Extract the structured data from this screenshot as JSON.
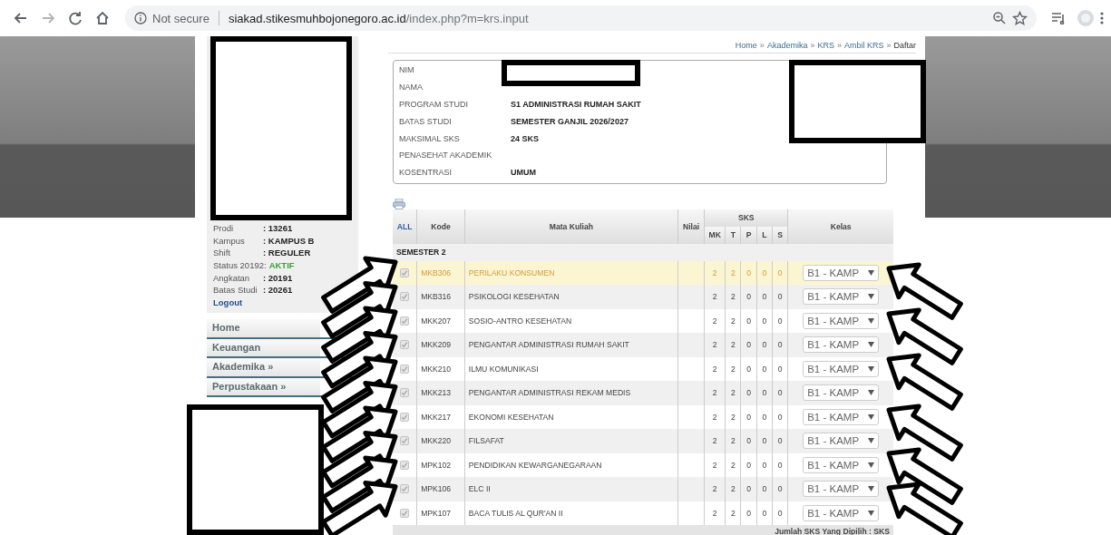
{
  "browser": {
    "security": "Not secure",
    "host": "siakad.stikesmuhbojonegoro.ac.id",
    "path": "/index.php?m=krs.input"
  },
  "sidebar": {
    "profile": [
      {
        "kind": "field",
        "label": "Prodi",
        "value": ": 13261"
      },
      {
        "kind": "field",
        "label": "Kampus",
        "value": ": KAMPUS B"
      },
      {
        "kind": "field",
        "label": "Shift",
        "value": ": REGULER"
      },
      {
        "kind": "status",
        "label": "Status 20192:",
        "value": "AKTIF"
      },
      {
        "kind": "field",
        "label": "Angkatan",
        "value": ": 20191"
      },
      {
        "kind": "field",
        "label": "Batas Studi",
        "value": ": 20261"
      }
    ],
    "logout": "Logout",
    "menu": [
      {
        "label": "Home"
      },
      {
        "label": "Keuangan"
      },
      {
        "label": "Akademika »"
      },
      {
        "label": "Perpustakaan »"
      }
    ]
  },
  "breadcrumb": {
    "separator": "»",
    "items": [
      {
        "label": "Home",
        "current": false
      },
      {
        "label": "Akademika",
        "current": false
      },
      {
        "label": "KRS",
        "current": false
      },
      {
        "label": "Ambil KRS",
        "current": false
      },
      {
        "label": "Daftar",
        "current": true
      }
    ]
  },
  "student": [
    {
      "label": "NIM"
    },
    {
      "label": "NAMA"
    },
    {
      "label": "PROGRAM STUDI",
      "value": "S1 ADMINISTRASI RUMAH SAKIT"
    },
    {
      "label": "BATAS STUDI",
      "value": "SEMESTER GANJIL 2026/2027"
    },
    {
      "label": "MAKSIMAL SKS",
      "value": "24 SKS"
    },
    {
      "label": "PENASEHAT AKADEMIK"
    },
    {
      "label": "KOSENTRASI",
      "value": "UMUM"
    }
  ],
  "table": {
    "select_all": "ALL",
    "columns": {
      "code": "Kode",
      "name": "Mata Kuliah",
      "grade": "Nilai",
      "sks": "SKS",
      "sks_parts": [
        "MK",
        "T",
        "P",
        "L",
        "S"
      ],
      "class": "Kelas"
    },
    "section": "SEMESTER 2",
    "rows": [
      {
        "code": "MKB306",
        "name": "PERILAKU KONSUMEN",
        "sks": [
          "2",
          "2",
          "0",
          "0",
          "0"
        ],
        "class": "B1 - KAMP",
        "checked": true,
        "disabled": true,
        "selected": true
      },
      {
        "code": "MKB316",
        "name": "PSIKOLOGI KESEHATAN",
        "sks": [
          "2",
          "2",
          "0",
          "0",
          "0"
        ],
        "class": "B1 - KAMP",
        "checked": true,
        "disabled": true,
        "selected": false
      },
      {
        "code": "MKK207",
        "name": "SOSIO-ANTRO KESEHATAN",
        "sks": [
          "2",
          "2",
          "0",
          "0",
          "0"
        ],
        "class": "B1 - KAMP",
        "checked": true,
        "disabled": true,
        "selected": false
      },
      {
        "code": "MKK209",
        "name": "PENGANTAR ADMINISTRASI RUMAH SAKIT",
        "sks": [
          "2",
          "2",
          "0",
          "0",
          "0"
        ],
        "class": "B1 - KAMP",
        "checked": true,
        "disabled": true,
        "selected": false
      },
      {
        "code": "MKK210",
        "name": "ILMU KOMUNIKASI",
        "sks": [
          "2",
          "2",
          "0",
          "0",
          "0"
        ],
        "class": "B1 - KAMP",
        "checked": true,
        "disabled": true,
        "selected": false
      },
      {
        "code": "MKK213",
        "name": "PENGANTAR ADMINISTRASI REKAM MEDIS",
        "sks": [
          "2",
          "2",
          "0",
          "0",
          "0"
        ],
        "class": "B1 - KAMP",
        "checked": true,
        "disabled": true,
        "selected": false
      },
      {
        "code": "MKK217",
        "name": "EKONOMI KESEHATAN",
        "sks": [
          "2",
          "2",
          "0",
          "0",
          "0"
        ],
        "class": "B1 - KAMP",
        "checked": true,
        "disabled": true,
        "selected": false
      },
      {
        "code": "MKK220",
        "name": "FILSAFAT",
        "sks": [
          "2",
          "2",
          "0",
          "0",
          "0"
        ],
        "class": "B1 - KAMP",
        "checked": true,
        "disabled": true,
        "selected": false
      },
      {
        "code": "MPK102",
        "name": "PENDIDIKAN KEWARGANEGARAAN",
        "sks": [
          "2",
          "2",
          "0",
          "0",
          "0"
        ],
        "class": "B1 - KAMP",
        "checked": true,
        "disabled": true,
        "selected": false
      },
      {
        "code": "MPK106",
        "name": "ELC II",
        "sks": [
          "2",
          "2",
          "0",
          "0",
          "0"
        ],
        "class": "B1 - KAMP",
        "checked": true,
        "disabled": true,
        "selected": false
      },
      {
        "code": "MPK107",
        "name": "BACA TULIS AL QUR'AN II",
        "sks": [
          "2",
          "2",
          "0",
          "0",
          "0"
        ],
        "class": "B1 - KAMP",
        "checked": true,
        "disabled": true,
        "selected": false
      }
    ],
    "footer": "Jumlah SKS Yang Dipilih : SKS"
  }
}
